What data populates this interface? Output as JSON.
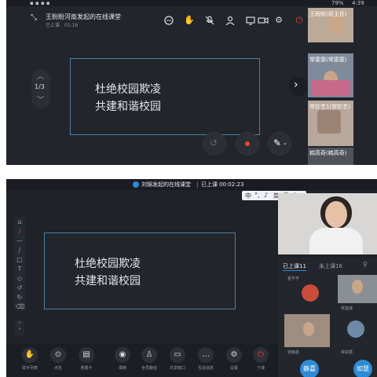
{
  "top_panel": {
    "status_right": "79%",
    "status_time": "4:39",
    "title": "王盼盼河南发起的在线课堂",
    "status_label": "已上课",
    "elapsed": "01:16",
    "page_indicator": "1/3",
    "board_lines": [
      "杜绝校园欺凌",
      "共建和谐校园"
    ],
    "participants": [
      {
        "name": "王盼盼(班主任)"
      },
      {
        "name": "常雯雯(常雯雯)"
      },
      {
        "name": "常妙艺1(常妙艺)"
      },
      {
        "name": "韩高奇(韩高奇)"
      }
    ],
    "icons": [
      "collapse-icon",
      "chat-icon",
      "hand-icon",
      "mic-off-icon",
      "user-icon",
      "screen-icon",
      "camera-icon",
      "settings-icon",
      "power-icon",
      "undo-icon",
      "record-icon",
      "pen-icon"
    ],
    "accent": "#e8452c"
  },
  "bottom_panel": {
    "title": "刘锦发起的在线课堂",
    "status_label": "已上课",
    "elapsed": "00:02:23",
    "ime_label": "中",
    "ime_items": [
      "中",
      "°,",
      "简"
    ],
    "board_lines": [
      "杜绝校园欺凌",
      "共建和谐校园"
    ],
    "tabs": {
      "attended": "已上课11",
      "not_attended": "未上课16"
    },
    "members": [
      {
        "name": "崔平平"
      },
      {
        "name": "常宜威"
      },
      {
        "name": "张静嘉"
      },
      {
        "name": "常如慧"
      }
    ],
    "avatar_text": [
      "静嘉",
      "如慧"
    ],
    "toolbar": [
      {
        "label": "举手列表",
        "icon": "hand-icon"
      },
      {
        "label": "点名",
        "icon": "location-icon"
      },
      {
        "label": "答题卡",
        "icon": "card-icon"
      },
      {
        "label": "录制",
        "icon": "record-icon"
      },
      {
        "label": "全员静音",
        "icon": "mute-all-icon"
      },
      {
        "label": "共享窗口",
        "icon": "share-screen-icon"
      },
      {
        "label": "互动消息",
        "icon": "message-icon"
      },
      {
        "label": "设置",
        "icon": "settings-icon"
      },
      {
        "label": "下课",
        "icon": "power-icon"
      }
    ],
    "accent": "#e8452c",
    "avatar_color": "#2e8bd8"
  }
}
